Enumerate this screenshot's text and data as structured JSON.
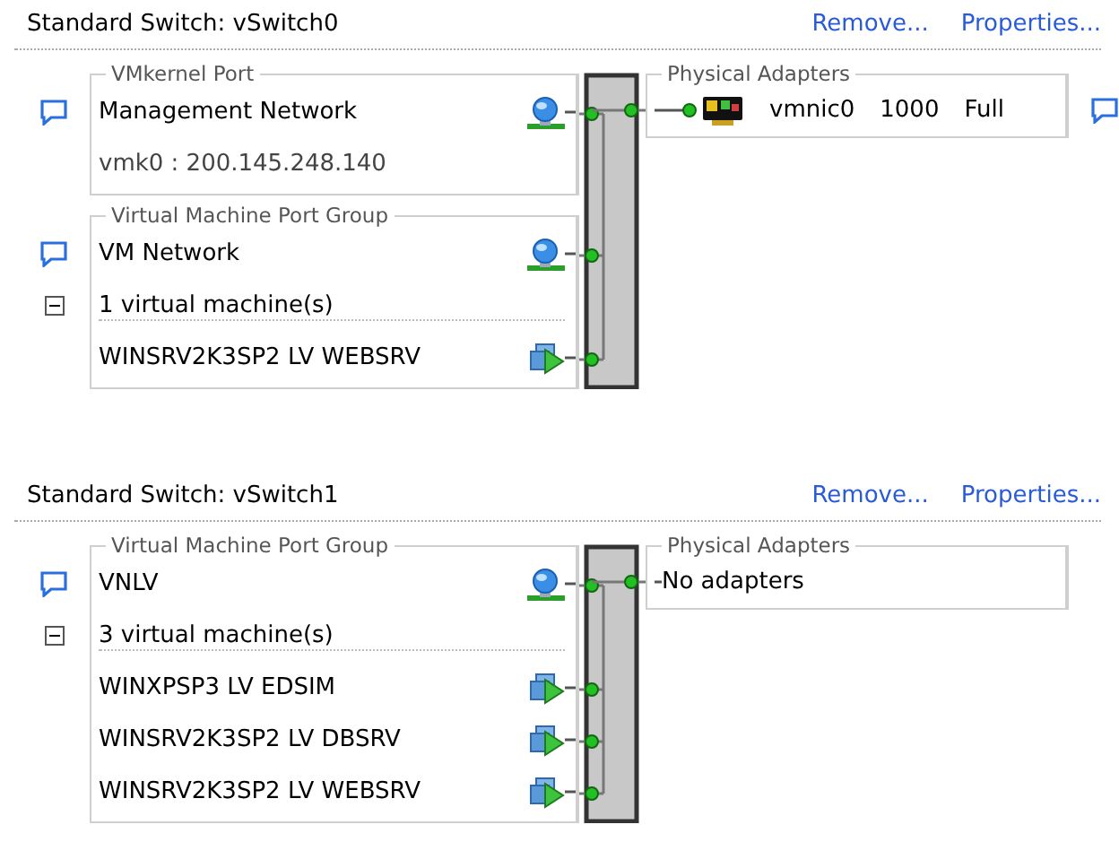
{
  "switches": [
    {
      "title": "Standard Switch: vSwitch0",
      "actions": [
        "Remove...",
        "Properties..."
      ],
      "port_groups": [
        {
          "type": "VMkernel Port",
          "rows": [
            {
              "kind": "port",
              "label": "Management Network"
            },
            {
              "kind": "info",
              "label": "vmk0 : 200.145.248.140"
            }
          ]
        },
        {
          "type": "Virtual Machine Port Group",
          "rows": [
            {
              "kind": "port",
              "label": "VM Network"
            },
            {
              "kind": "vm_count",
              "label": "1 virtual machine(s)",
              "expanded": true
            },
            {
              "kind": "vm",
              "label": "WINSRV2K3SP2 LV WEBSRV"
            }
          ]
        }
      ],
      "adapters": {
        "legend": "Physical Adapters",
        "items": [
          {
            "name": "vmnic0",
            "speed": "1000",
            "duplex": "Full"
          }
        ]
      }
    },
    {
      "title": "Standard Switch: vSwitch1",
      "actions": [
        "Remove...",
        "Properties..."
      ],
      "port_groups": [
        {
          "type": "Virtual Machine Port Group",
          "rows": [
            {
              "kind": "port",
              "label": "VNLV"
            },
            {
              "kind": "vm_count",
              "label": "3 virtual machine(s)",
              "expanded": true
            },
            {
              "kind": "vm",
              "label": "WINXPSP3 LV EDSIM"
            },
            {
              "kind": "vm",
              "label": "WINSRV2K3SP2 LV DBSRV"
            },
            {
              "kind": "vm",
              "label": "WINSRV2K3SP2 LV WEBSRV"
            }
          ]
        }
      ],
      "adapters": {
        "legend": "Physical Adapters",
        "empty_text": "No adapters"
      }
    }
  ]
}
